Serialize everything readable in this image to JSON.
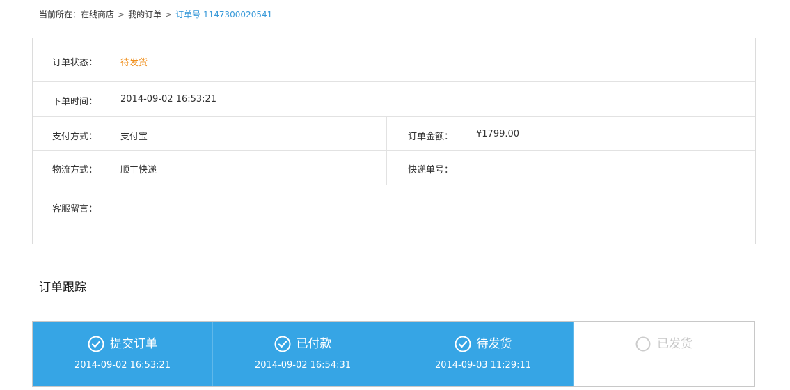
{
  "breadcrumb": {
    "prefix": "当前所在：",
    "items": [
      "在线商店",
      "我的订单"
    ],
    "separator": ">",
    "current": "订单号 1147300020541"
  },
  "order": {
    "status_label": "订单状态：",
    "status_value": "待发货",
    "time_label": "下单时间：",
    "time_value": "2014-09-02 16:53:21",
    "payment_label": "支付方式：",
    "payment_value": "支付宝",
    "amount_label": "订单金额：",
    "amount_value": "¥1799.00",
    "shipping_label": "物流方式：",
    "shipping_value": "顺丰快递",
    "tracking_label": "快递单号：",
    "tracking_value": "",
    "note_label": "客服留言：",
    "note_value": ""
  },
  "tracking": {
    "title": "订单跟踪",
    "steps": [
      {
        "label": "提交订单",
        "time": "2014-09-02 16:53:21",
        "done": true
      },
      {
        "label": "已付款",
        "time": "2014-09-02 16:54:31",
        "done": true
      },
      {
        "label": "待发货",
        "time": "2014-09-03 11:29:11",
        "done": true
      },
      {
        "label": "已发货",
        "time": "",
        "done": false
      }
    ]
  },
  "colors": {
    "accent": "#36a5e5",
    "status_orange": "#f0901e",
    "link_blue": "#3a9ad9"
  }
}
